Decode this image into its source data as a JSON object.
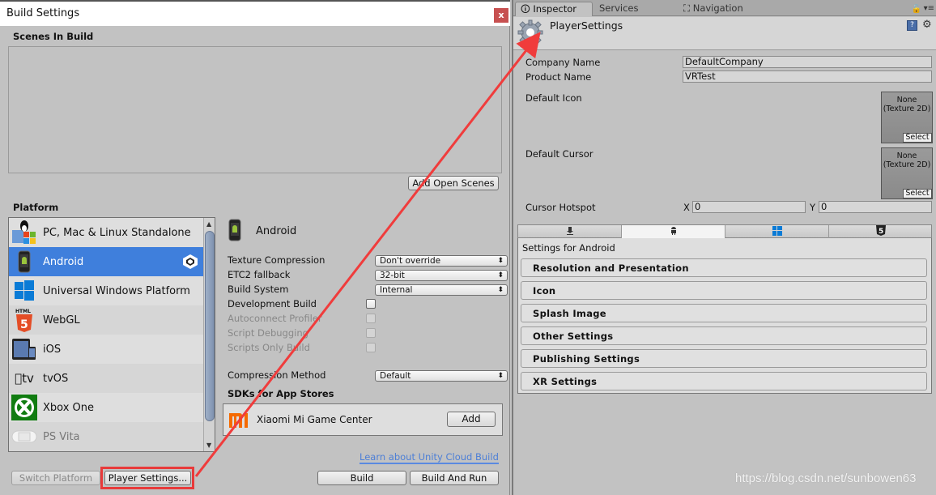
{
  "build_settings": {
    "title": "Build Settings",
    "close_label": "x",
    "scenes_title": "Scenes In Build",
    "add_open_scenes": "Add Open Scenes",
    "platform_title": "Platform",
    "platforms": [
      {
        "label": "PC, Mac & Linux Standalone",
        "icon": "pc-mac-linux-icon"
      },
      {
        "label": "Android",
        "icon": "android-icon",
        "selected": true,
        "active_badge": "unity-logo-icon"
      },
      {
        "label": "Universal Windows Platform",
        "icon": "windows-icon"
      },
      {
        "label": "WebGL",
        "icon": "html5-icon"
      },
      {
        "label": "iOS",
        "icon": "ios-devices-icon"
      },
      {
        "label": "tvOS",
        "icon": "apple-tv-icon"
      },
      {
        "label": "Xbox One",
        "icon": "xbox-icon"
      },
      {
        "label": "PS Vita",
        "icon": "ps-vita-icon"
      }
    ],
    "switch_platform": "Switch Platform",
    "player_settings": "Player Settings...",
    "android_panel": {
      "header": "Android",
      "texture_compression": {
        "label": "Texture Compression",
        "value": "Don't override"
      },
      "etc2_fallback": {
        "label": "ETC2 fallback",
        "value": "32-bit"
      },
      "build_system": {
        "label": "Build System",
        "value": "Internal"
      },
      "development_build": {
        "label": "Development Build",
        "checked": false
      },
      "autoconnect_profiler": {
        "label": "Autoconnect Profiler",
        "checked": false,
        "disabled": true
      },
      "script_debugging": {
        "label": "Script Debugging",
        "checked": false,
        "disabled": true
      },
      "scripts_only_build": {
        "label": "Scripts Only Build",
        "checked": false,
        "disabled": true
      },
      "compression_method": {
        "label": "Compression Method",
        "value": "Default"
      },
      "sdk_title": "SDKs for App Stores",
      "sdk_name": "Xiaomi Mi Game Center",
      "sdk_add": "Add",
      "cloud_link": "Learn about Unity Cloud Build",
      "build": "Build",
      "build_and_run": "Build And Run"
    }
  },
  "inspector": {
    "tabs": [
      {
        "label": "Inspector",
        "icon": "info-icon",
        "active": true
      },
      {
        "label": "Services"
      },
      {
        "label": "Navigation",
        "icon": "navigation-icon"
      }
    ],
    "object_title": "PlayerSettings",
    "company_name": {
      "label": "Company Name",
      "value": "DefaultCompany"
    },
    "product_name": {
      "label": "Product Name",
      "value": "VRTest"
    },
    "default_icon": {
      "label": "Default Icon",
      "slot_text": "None (Texture 2D)",
      "select": "Select"
    },
    "default_cursor": {
      "label": "Default Cursor",
      "slot_text": "None (Texture 2D)",
      "select": "Select"
    },
    "cursor_hotspot": {
      "label": "Cursor Hotspot",
      "x_label": "X",
      "x": "0",
      "y_label": "Y",
      "y": "0"
    },
    "platform_tabs": [
      "standalone-download-icon",
      "android-icon",
      "windows-icon",
      "html5-icon"
    ],
    "active_platform_tab": 1,
    "settings_for": "Settings for Android",
    "sections": [
      "Resolution and Presentation",
      "Icon",
      "Splash Image",
      "Other Settings",
      "Publishing Settings",
      "XR Settings"
    ]
  },
  "watermark": "https://blog.csdn.net/sunbowen63",
  "colors": {
    "selection": "#3f7fdc",
    "highlight_annotation": "#e83a3a",
    "link": "#4d7fd6",
    "close": "#c75050"
  }
}
